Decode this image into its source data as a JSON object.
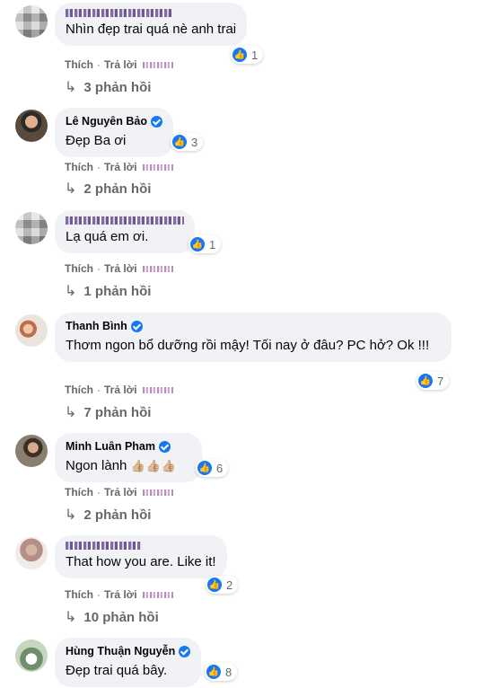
{
  "labels": {
    "like": "Thích",
    "reply": "Trả lời",
    "separator": "·"
  },
  "icons": {
    "reaction": "like-icon",
    "reply_arrow": "reply-arrow-icon",
    "verified": "verified-badge-icon"
  },
  "colors": {
    "accent": "#1877f2",
    "bubble": "#f0f2f5",
    "muted": "#65676b"
  },
  "comments": [
    {
      "name": "",
      "verified": false,
      "text": "Nhìn đẹp trai quá nè anh trai",
      "reactions": "1",
      "replies": "3 phản hồi"
    },
    {
      "name": "Lê Nguyên Bảo",
      "verified": true,
      "text": "Đẹp Ba ơi",
      "reactions": "3",
      "replies": "2 phản hồi"
    },
    {
      "name": "",
      "verified": false,
      "text": "Lạ quá em ơi.",
      "reactions": "1",
      "replies": "1 phản hồi"
    },
    {
      "name": "Thanh Bình",
      "verified": true,
      "text": "Thơm ngon bổ dưỡng rồi mậy! Tối nay ở đâu? PC hở? Ok !!!",
      "reactions": "7",
      "replies": "7 phản hồi"
    },
    {
      "name": "Minh Luân Pham",
      "verified": true,
      "text": "Ngon lành",
      "emoji": "👍🏼👍🏼👍🏼",
      "reactions": "6",
      "replies": "2 phản hồi"
    },
    {
      "name": "",
      "verified": false,
      "text": "That how you are. Like it!",
      "reactions": "2",
      "replies": "10 phản hồi"
    },
    {
      "name": "Hùng Thuận Nguyễn",
      "verified": true,
      "text": "Đẹp trai quá bây.",
      "reactions": "8"
    }
  ]
}
